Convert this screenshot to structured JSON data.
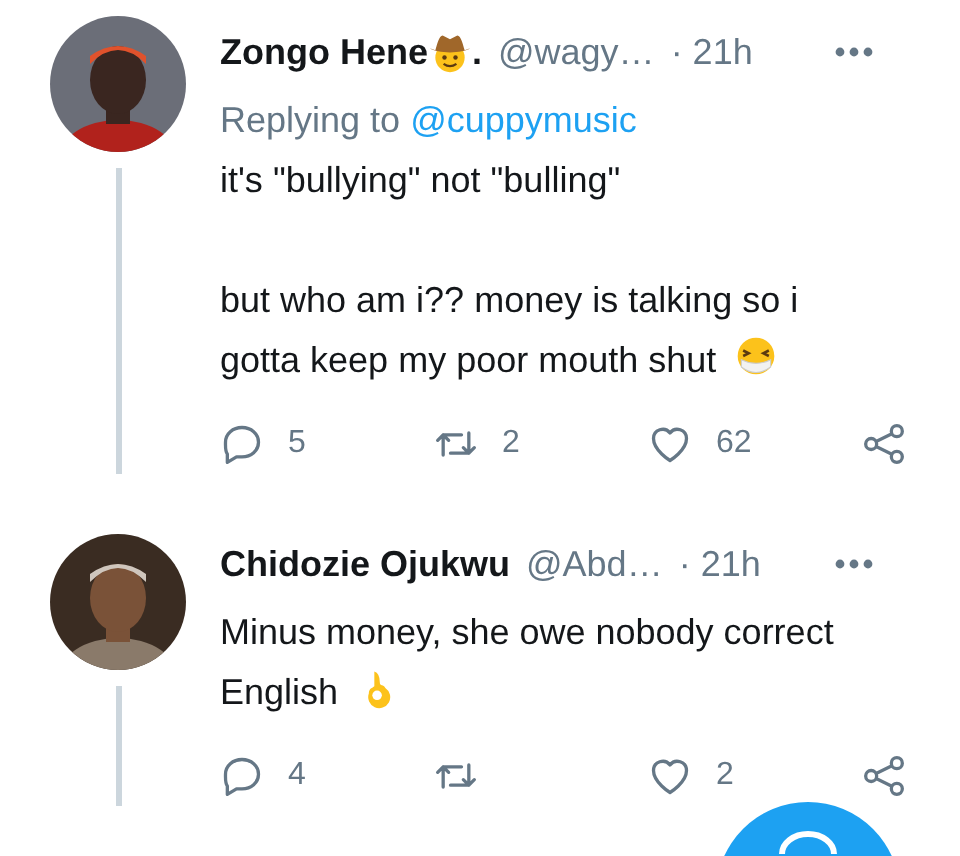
{
  "tweets": [
    {
      "name": "Zongo Hene",
      "name_icon": {
        "kind": "cowboy"
      },
      "name_suffix": ".",
      "handle": "@wagy…",
      "time": "· 21h",
      "replying_to": {
        "label": "Replying to",
        "handle": "@cuppymusic"
      },
      "paragraphs": [
        "it's \"bullying\" not \"bulling\"",
        "but who am i?? money is talking so i gotta keep my poor mouth shut"
      ],
      "end_icon": {
        "kind": "mask"
      },
      "avatar": {
        "kind": "picture"
      },
      "actions": {
        "replies": "5",
        "retweets": "2",
        "likes": "62"
      }
    },
    {
      "name": "Chidozie Ojukwu",
      "handle": "@Abd…",
      "time": "· 21h",
      "paragraphs": [
        "Minus money, she owe nobody correct English"
      ],
      "end_icon": {
        "kind": "ok_hand"
      },
      "avatar": {
        "kind": "picture"
      },
      "actions": {
        "replies": "4",
        "likes": "2"
      }
    }
  ]
}
